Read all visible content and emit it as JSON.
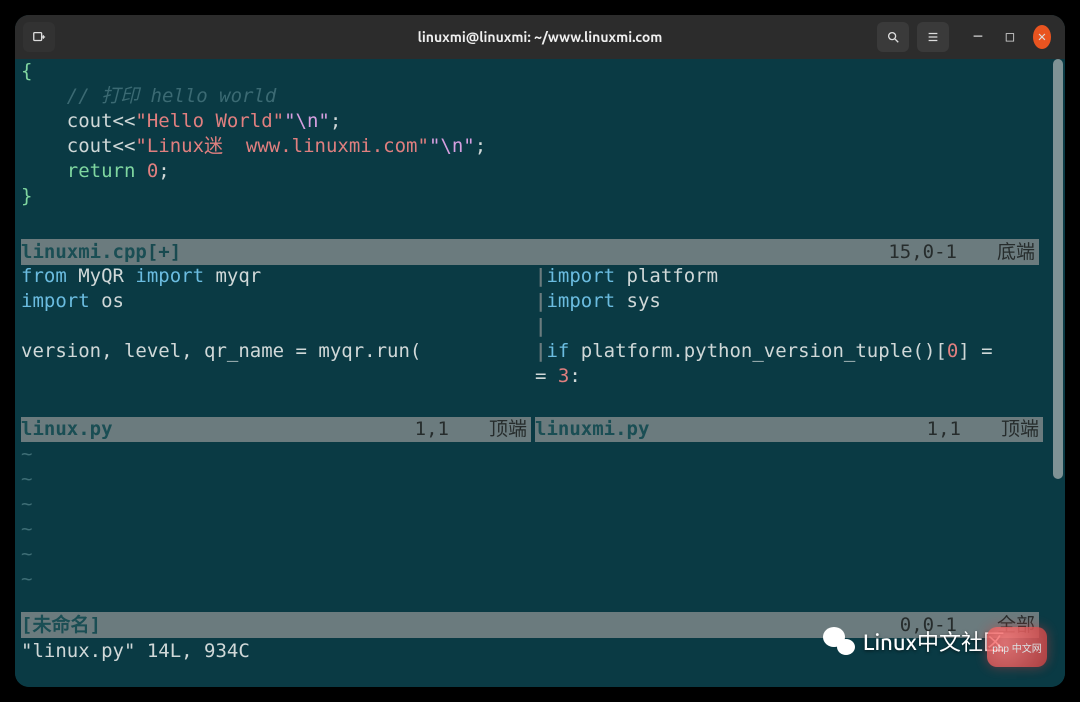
{
  "titlebar": {
    "title": "linuxmi@linuxmi: ~/www.linuxmi.com"
  },
  "panes": {
    "cpp": {
      "brace_open": "{",
      "comment": "    // 打印 hello world",
      "l1_pre": "    cout<<",
      "l1_str": "\"Hello World\"",
      "l1_esc": "\"\\n\"",
      "l1_semi": ";",
      "l2_pre": "    cout<<",
      "l2_str": "\"Linux迷  www.linuxmi.com\"",
      "l2_esc": "\"\\n\"",
      "l2_semi": ";",
      "ret_kw": "    return ",
      "ret_val": "0",
      "ret_semi": ";",
      "brace_close": "}",
      "status_file": "linuxmi.cpp",
      "status_mod": " [+]",
      "status_pos": "15,0-1",
      "status_pct": "底端"
    },
    "py_left": {
      "l1_from": "from",
      "l1_mod": " MyQR ",
      "l1_import": "import",
      "l1_name": " myqr",
      "l2_import": "import",
      "l2_mod": " os",
      "l3_blank": " ",
      "l4": "version, level, qr_name = myqr.run(",
      "status_file": "linux.py",
      "status_pos": "1,1",
      "status_pct": "顶端"
    },
    "py_right": {
      "border": "|",
      "l1_import": "import",
      "l1_mod": " platform",
      "l2_import": "import",
      "l2_mod": " sys",
      "l3_blank": " ",
      "l4_if": "if",
      "l4_rest": " platform.python_version_tuple()[",
      "l4_idx": "0",
      "l4_end": "] =",
      "l5": "= ",
      "l5_num": "3",
      "l5_end": ":",
      "status_file": "linuxmi.py",
      "status_pos": "1,1",
      "status_pct": "顶端"
    },
    "bottom": {
      "status_file": "[未命名]",
      "status_pos": "0,0-1",
      "status_pct": "全部"
    }
  },
  "cmdline": "\"linux.py\" 14L, 934C",
  "watermark1": "Linux中文社区",
  "watermark2": "php 中文网"
}
